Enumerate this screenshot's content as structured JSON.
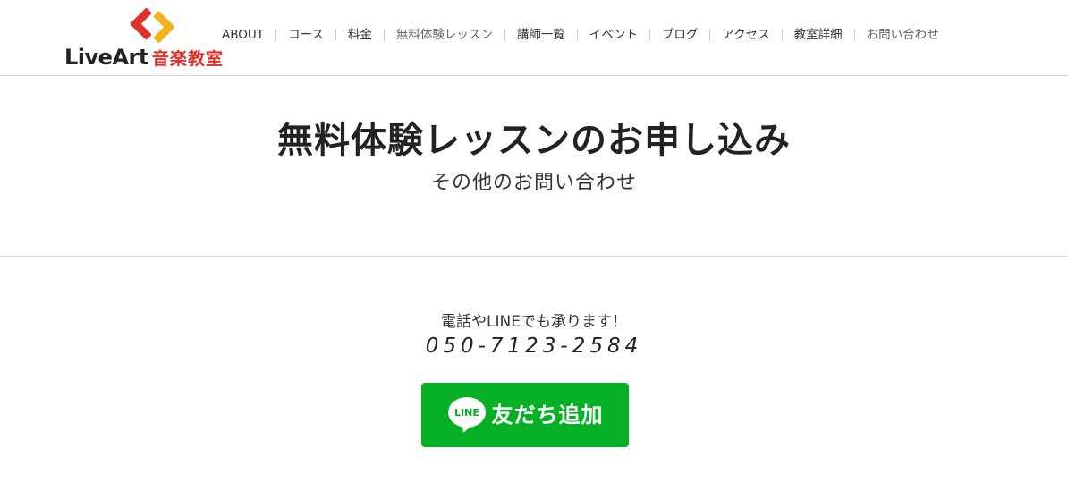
{
  "header": {
    "logo": {
      "text_en": "LiveArt",
      "text_ja": "音楽教室",
      "mark_icon": "liveart-logo-mark-icon",
      "colors": {
        "red": "#e0302c",
        "yellow": "#f3b21c",
        "dark": "#222222"
      }
    },
    "nav": [
      {
        "label": "ABOUT",
        "muted": false
      },
      {
        "label": "コース",
        "muted": false
      },
      {
        "label": "料金",
        "muted": false
      },
      {
        "label": "無料体験レッスン",
        "muted": true
      },
      {
        "label": "講師一覧",
        "muted": false
      },
      {
        "label": "イベント",
        "muted": false
      },
      {
        "label": "ブログ",
        "muted": false
      },
      {
        "label": "アクセス",
        "muted": false
      },
      {
        "label": "教室詳細",
        "muted": false
      },
      {
        "label": "お問い合わせ",
        "muted": true
      }
    ]
  },
  "hero": {
    "title": "無料体験レッスンのお申し込み",
    "subtitle": "その他のお問い合わせ"
  },
  "contact": {
    "lead": "電話やLINEでも承ります！",
    "phone": "050-7123-2584",
    "line_button": {
      "icon": "line-logo-icon",
      "badge_text": "LINE",
      "label": "友だち追加",
      "color": "#06b025"
    }
  }
}
